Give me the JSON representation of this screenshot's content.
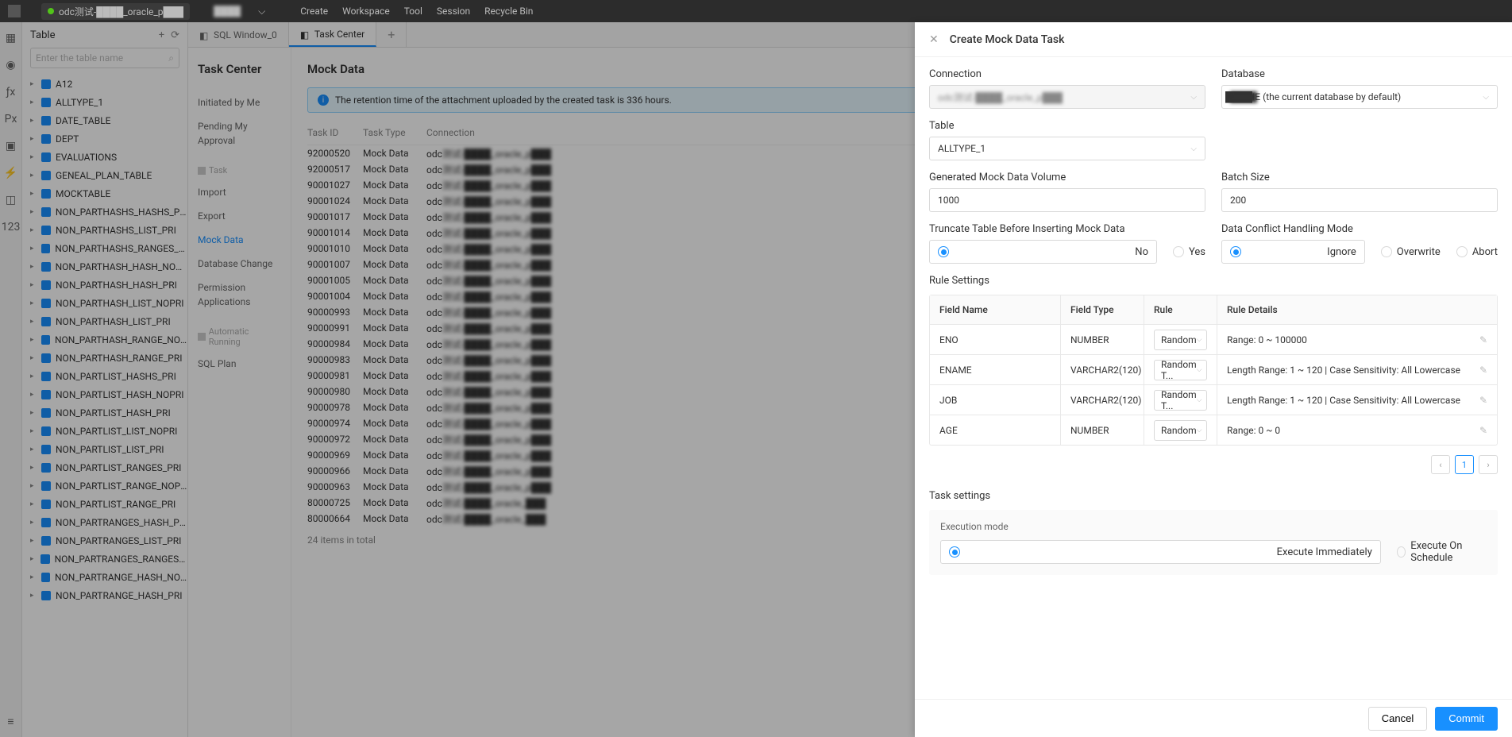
{
  "topbar": {
    "connection": "odc测试-████_oracle_p███",
    "user": "████",
    "menu": [
      "Create",
      "Workspace",
      "Tool",
      "Session",
      "Recycle Bin"
    ]
  },
  "sidebar": {
    "title": "Table",
    "search_placeholder": "Enter the table name",
    "tables": [
      "A12",
      "ALLTYPE_1",
      "DATE_TABLE",
      "DEPT",
      "EVALUATIONS",
      "GENEAL_PLAN_TABLE",
      "MOCKTABLE",
      "NON_PARTHASHS_HASHS_PRI",
      "NON_PARTHASHS_LIST_PRI",
      "NON_PARTHASHS_RANGES_PRI",
      "NON_PARTHASH_HASH_NOPRI",
      "NON_PARTHASH_HASH_PRI",
      "NON_PARTHASH_LIST_NOPRI",
      "NON_PARTHASH_LIST_PRI",
      "NON_PARTHASH_RANGE_NOPRI",
      "NON_PARTHASH_RANGE_PRI",
      "NON_PARTLIST_HASHS_PRI",
      "NON_PARTLIST_HASH_NOPRI",
      "NON_PARTLIST_HASH_PRI",
      "NON_PARTLIST_LIST_NOPRI",
      "NON_PARTLIST_LIST_PRI",
      "NON_PARTLIST_RANGES_PRI",
      "NON_PARTLIST_RANGE_NOPRI",
      "NON_PARTLIST_RANGE_PRI",
      "NON_PARTRANGES_HASH_PRI",
      "NON_PARTRANGES_LIST_PRI",
      "NON_PARTRANGES_RANGES_PRI",
      "NON_PARTRANGE_HASH_NOPRI",
      "NON_PARTRANGE_HASH_PRI"
    ]
  },
  "tabs": {
    "sql": "SQL Window_0",
    "tc": "Task Center"
  },
  "taskcenter": {
    "title": "Task Center",
    "links": {
      "initiated": "Initiated by Me",
      "pending": "Pending My Approval",
      "group_task": "Task",
      "import": "Import",
      "export": "Export",
      "mock": "Mock Data",
      "dbchange": "Database Change",
      "permission": "Permission Applications",
      "auto": "Automatic Running",
      "sqlplan": "SQL Plan"
    },
    "page_title": "Mock Data",
    "alert": "The retention time of the attachment uploaded by the created task is 336 hours.",
    "cols": {
      "id": "Task ID",
      "type": "Task Type",
      "conn": "Connection"
    },
    "rows": [
      {
        "id": "92000520",
        "type": "Mock Data",
        "conn": "odc测试-████_oracle_p███"
      },
      {
        "id": "92000517",
        "type": "Mock Data",
        "conn": "odc测试-████_oracle_p███"
      },
      {
        "id": "90001027",
        "type": "Mock Data",
        "conn": "odc测试-████_oracle_p███"
      },
      {
        "id": "90001024",
        "type": "Mock Data",
        "conn": "odc测试-████_oracle_p███"
      },
      {
        "id": "90001017",
        "type": "Mock Data",
        "conn": "odc测试-████_oracle_p███"
      },
      {
        "id": "90001014",
        "type": "Mock Data",
        "conn": "odc测试-████_oracle_p███"
      },
      {
        "id": "90001010",
        "type": "Mock Data",
        "conn": "odc测试-████_oracle_p███"
      },
      {
        "id": "90001007",
        "type": "Mock Data",
        "conn": "odc测试-████_oracle_p███"
      },
      {
        "id": "90001005",
        "type": "Mock Data",
        "conn": "odc测试-████_oracle_p███"
      },
      {
        "id": "90001004",
        "type": "Mock Data",
        "conn": "odc测试-████_oracle_p███"
      },
      {
        "id": "90000993",
        "type": "Mock Data",
        "conn": "odc测试-████_oracle_p███"
      },
      {
        "id": "90000991",
        "type": "Mock Data",
        "conn": "odc测试-████_oracle_p███"
      },
      {
        "id": "90000984",
        "type": "Mock Data",
        "conn": "odc测试-████_oracle_p███"
      },
      {
        "id": "90000983",
        "type": "Mock Data",
        "conn": "odc测试-████_oracle_p███"
      },
      {
        "id": "90000981",
        "type": "Mock Data",
        "conn": "odc测试-████_oracle_p███"
      },
      {
        "id": "90000980",
        "type": "Mock Data",
        "conn": "odc测试-████_oracle_p███"
      },
      {
        "id": "90000978",
        "type": "Mock Data",
        "conn": "odc测试-████_oracle_p███"
      },
      {
        "id": "90000974",
        "type": "Mock Data",
        "conn": "odc测试-████_oracle_p███"
      },
      {
        "id": "90000972",
        "type": "Mock Data",
        "conn": "odc测试-████_oracle_p███"
      },
      {
        "id": "90000969",
        "type": "Mock Data",
        "conn": "odc测试-████_oracle_p███"
      },
      {
        "id": "90000966",
        "type": "Mock Data",
        "conn": "odc测试-████_oracle_p███"
      },
      {
        "id": "90000963",
        "type": "Mock Data",
        "conn": "odc测试-████_oracle_p███"
      },
      {
        "id": "80000725",
        "type": "Mock Data",
        "conn": "odc测试-████_oracle_███"
      },
      {
        "id": "80000664",
        "type": "Mock Data",
        "conn": "odc测试-████_oracle_███"
      }
    ],
    "footer": "24 items in total"
  },
  "drawer": {
    "title": "Create Mock Data Task",
    "labels": {
      "connection": "Connection",
      "database": "Database",
      "table": "Table",
      "volume": "Generated Mock Data Volume",
      "batch": "Batch Size",
      "truncate": "Truncate Table Before Inserting Mock Data",
      "conflict": "Data Conflict Handling Mode",
      "rule_settings": "Rule Settings",
      "task_settings": "Task settings",
      "exec_mode": "Execution mode"
    },
    "values": {
      "connection": "odc测试-████_oracle_p███",
      "database": "████IE (the current database by default)",
      "table": "ALLTYPE_1",
      "volume": "1000",
      "batch": "200"
    },
    "radios": {
      "no": "No",
      "yes": "Yes",
      "ignore": "Ignore",
      "overwrite": "Overwrite",
      "abort": "Abort",
      "exec_now": "Execute Immediately",
      "exec_sched": "Execute On Schedule"
    },
    "rule_cols": {
      "field": "Field Name",
      "type": "Field Type",
      "rule": "Rule",
      "details": "Rule Details"
    },
    "rules": [
      {
        "field": "ENO",
        "type": "NUMBER",
        "rule": "Random",
        "details": "Range: 0 ~ 100000"
      },
      {
        "field": "ENAME",
        "type": "VARCHAR2(120)",
        "rule": "Random T...",
        "details": "Length Range: 1 ~ 120 | Case Sensitivity: All Lowercase"
      },
      {
        "field": "JOB",
        "type": "VARCHAR2(120)",
        "rule": "Random T...",
        "details": "Length Range: 1 ~ 120 | Case Sensitivity: All Lowercase"
      },
      {
        "field": "AGE",
        "type": "NUMBER",
        "rule": "Random",
        "details": "Range: 0 ~ 0"
      }
    ],
    "page": "1",
    "buttons": {
      "cancel": "Cancel",
      "commit": "Commit"
    }
  }
}
